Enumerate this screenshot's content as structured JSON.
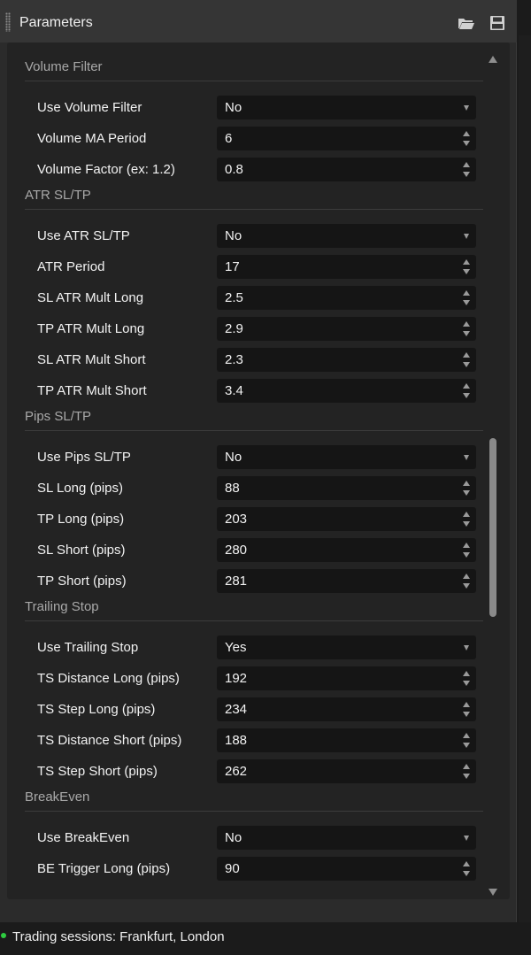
{
  "header": {
    "title": "Parameters"
  },
  "icons": {
    "open": "folder-open-icon",
    "save": "save-disk-icon"
  },
  "sections": [
    {
      "title": "Volume Filter",
      "rows": [
        {
          "label": "Use Volume Filter",
          "value": "No",
          "control": "dropdown"
        },
        {
          "label": "Volume MA Period",
          "value": "6",
          "control": "spinner"
        },
        {
          "label": "Volume Factor (ex: 1.2)",
          "value": "0.8",
          "control": "spinner"
        }
      ]
    },
    {
      "title": "ATR SL/TP",
      "rows": [
        {
          "label": "Use ATR SL/TP",
          "value": "No",
          "control": "dropdown"
        },
        {
          "label": "ATR Period",
          "value": "17",
          "control": "spinner"
        },
        {
          "label": "SL ATR Mult Long",
          "value": "2.5",
          "control": "spinner"
        },
        {
          "label": "TP ATR Mult Long",
          "value": "2.9",
          "control": "spinner"
        },
        {
          "label": "SL ATR Mult Short",
          "value": "2.3",
          "control": "spinner"
        },
        {
          "label": "TP ATR Mult Short",
          "value": "3.4",
          "control": "spinner"
        }
      ]
    },
    {
      "title": "Pips SL/TP",
      "rows": [
        {
          "label": "Use Pips SL/TP",
          "value": "No",
          "control": "dropdown"
        },
        {
          "label": "SL Long (pips)",
          "value": "88",
          "control": "spinner"
        },
        {
          "label": "TP Long (pips)",
          "value": "203",
          "control": "spinner"
        },
        {
          "label": "SL Short (pips)",
          "value": "280",
          "control": "spinner"
        },
        {
          "label": "TP Short (pips)",
          "value": "281",
          "control": "spinner"
        }
      ]
    },
    {
      "title": "Trailing Stop",
      "rows": [
        {
          "label": "Use Trailing Stop",
          "value": "Yes",
          "control": "dropdown"
        },
        {
          "label": "TS Distance Long (pips)",
          "value": "192",
          "control": "spinner"
        },
        {
          "label": "TS Step Long (pips)",
          "value": "234",
          "control": "spinner"
        },
        {
          "label": "TS Distance Short (pips)",
          "value": "188",
          "control": "spinner"
        },
        {
          "label": "TS Step Short (pips)",
          "value": "262",
          "control": "spinner"
        }
      ]
    },
    {
      "title": "BreakEven",
      "rows": [
        {
          "label": "Use BreakEven",
          "value": "No",
          "control": "dropdown"
        },
        {
          "label": "BE Trigger Long (pips)",
          "value": "90",
          "control": "spinner"
        }
      ]
    }
  ],
  "status": {
    "text": "Trading sessions: Frankfurt, London",
    "dot_color": "#2ecc40"
  },
  "colors": {
    "panel_bg": "#2b2b2b",
    "field_bg": "#151515",
    "section_text": "#a8a8a8"
  }
}
